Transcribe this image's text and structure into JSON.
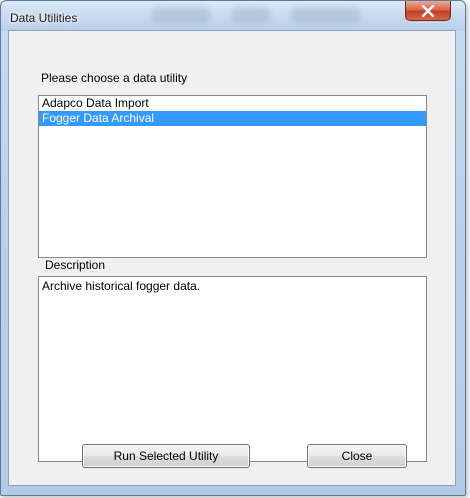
{
  "window": {
    "title": "Data Utilities"
  },
  "utilities": {
    "prompt": "Please choose a data utility",
    "items": [
      {
        "label": "Adapco Data Import",
        "selected": false
      },
      {
        "label": "Fogger Data Archival",
        "selected": true
      }
    ],
    "selection_color": "#3399ff"
  },
  "description": {
    "label": "Description",
    "text": "Archive historical fogger data."
  },
  "buttons": {
    "run_label": "Run Selected Utility",
    "close_label": "Close"
  },
  "icons": {
    "title_close": "close-icon"
  },
  "colors": {
    "close_button": "#c23b1f",
    "frame": "#b9cfe9"
  }
}
